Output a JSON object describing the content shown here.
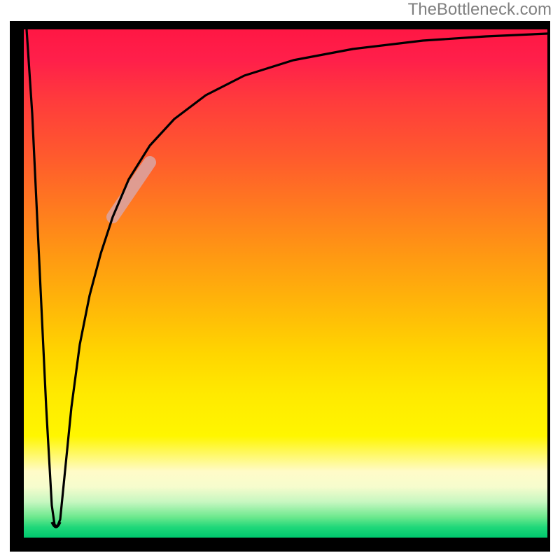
{
  "watermark": "TheBottleneck.com",
  "chart_data": {
    "type": "line",
    "title": "",
    "xlabel": "",
    "ylabel": "",
    "xlim": [
      0,
      100
    ],
    "ylim": [
      0,
      100
    ],
    "grid": false,
    "series": [
      {
        "name": "bottleneck-curve",
        "x": [
          0.5,
          1.5,
          3,
          4.5,
          6,
          8,
          10,
          12,
          14,
          17,
          20,
          24,
          28,
          34,
          42,
          52,
          64,
          78,
          100
        ],
        "y": [
          100,
          82,
          52,
          20,
          3,
          18,
          35,
          46,
          55,
          63,
          69,
          74,
          78,
          82,
          86,
          90,
          93,
          95,
          97
        ]
      }
    ],
    "annotations": [
      {
        "name": "highlight-segment",
        "x_range": [
          17,
          24
        ],
        "y_range": [
          64,
          75
        ],
        "note": "faded pink band over curve"
      }
    ],
    "trough": {
      "x": 6,
      "y": 3
    }
  },
  "colors": {
    "frame": "#000000",
    "curve": "#000000",
    "highlight": "#e2a7a7",
    "watermark": "#808080",
    "gradient_stops": [
      "#ff1744",
      "#ff5a2d",
      "#ff9a12",
      "#ffd600",
      "#fff600",
      "#fffbc8",
      "#6be88d",
      "#00c86e"
    ]
  }
}
